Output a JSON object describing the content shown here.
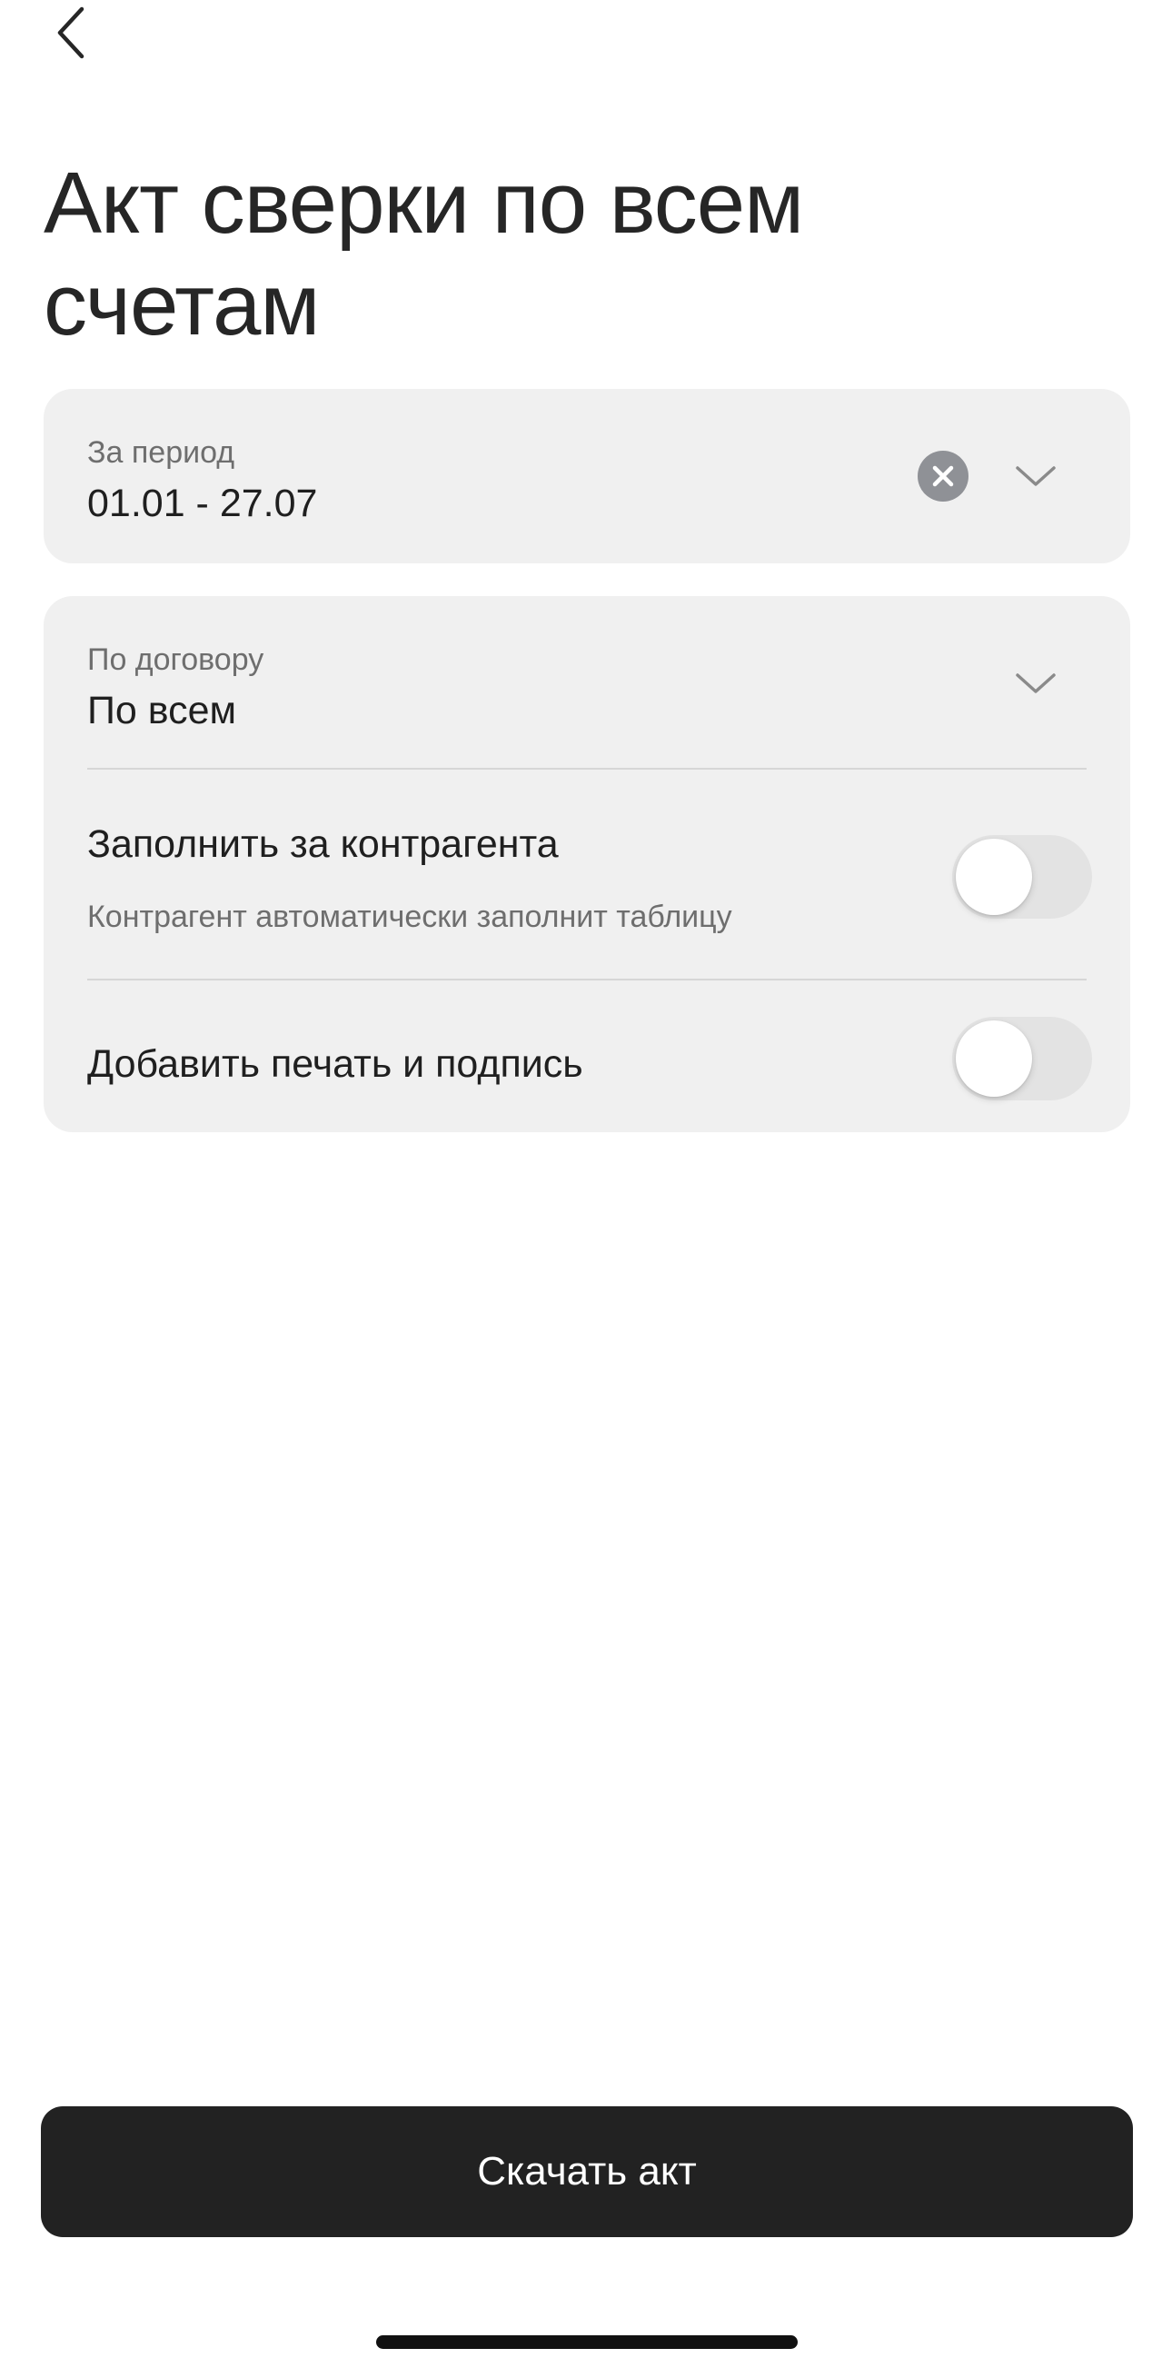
{
  "header": {
    "back_icon": "chevron-left-icon",
    "title": "Акт сверки по всем счетам"
  },
  "period": {
    "label": "За период",
    "value": "01.01 - 27.07",
    "clear_icon": "clear-icon",
    "expand_icon": "chevron-down-icon"
  },
  "contract": {
    "label": "По договору",
    "value": "По всем",
    "expand_icon": "chevron-down-icon"
  },
  "options": [
    {
      "title": "Заполнить за контрагента",
      "subtitle": "Контрагент автоматически заполнит таблицу",
      "enabled": false
    },
    {
      "title": "Добавить печать и подпись",
      "enabled": false
    }
  ],
  "actions": {
    "download_label": "Скачать акт"
  },
  "colors": {
    "card_bg": "#f0f0f0",
    "button_bg": "#222222",
    "toggle_off": "#e3e3e3",
    "clear_bg": "#8f9196"
  }
}
